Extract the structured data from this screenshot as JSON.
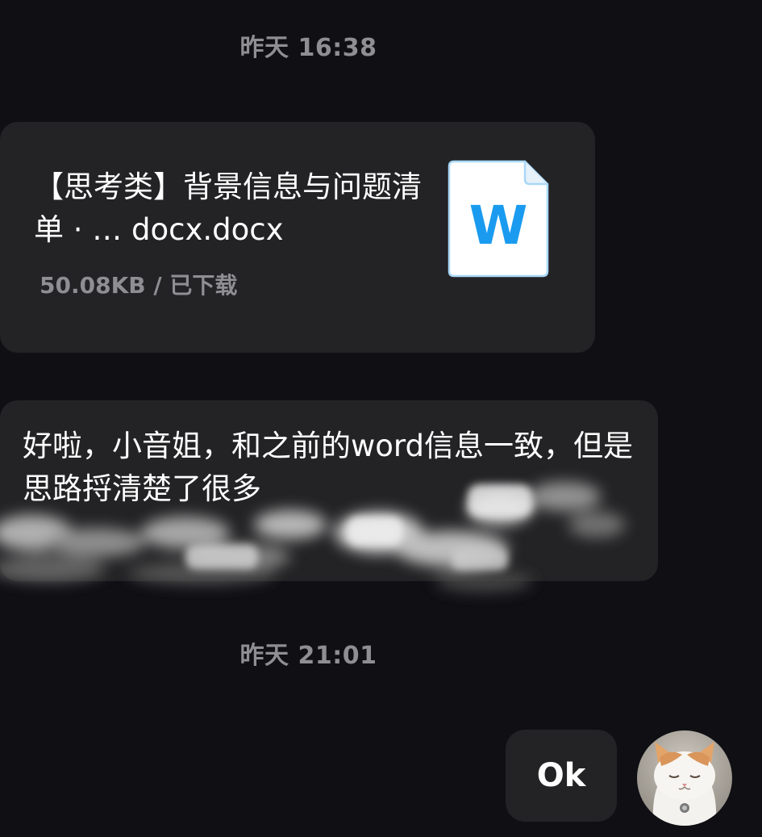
{
  "chat": {
    "messages": [
      {
        "timestamp": "昨天 16:38",
        "file": {
          "name": "【思考类】背景信息与问题清单 · … docx.docx",
          "meta": "50.08KB / 已下载",
          "icon": "word-document-icon",
          "icon_letter": "W",
          "icon_color": "#1a9bf0"
        }
      },
      {
        "text": "好啦，小音姐，和之前的word信息一致，但是思路捋清楚了很多"
      },
      {
        "timestamp": "昨天 21:01",
        "text": "Ok",
        "avatar_icon": "cat-avatar-icon"
      }
    ]
  },
  "colors": {
    "background": "#0f0f14",
    "bubble": "#232325",
    "timestamp": "#8e8e93",
    "text": "#ffffff"
  }
}
